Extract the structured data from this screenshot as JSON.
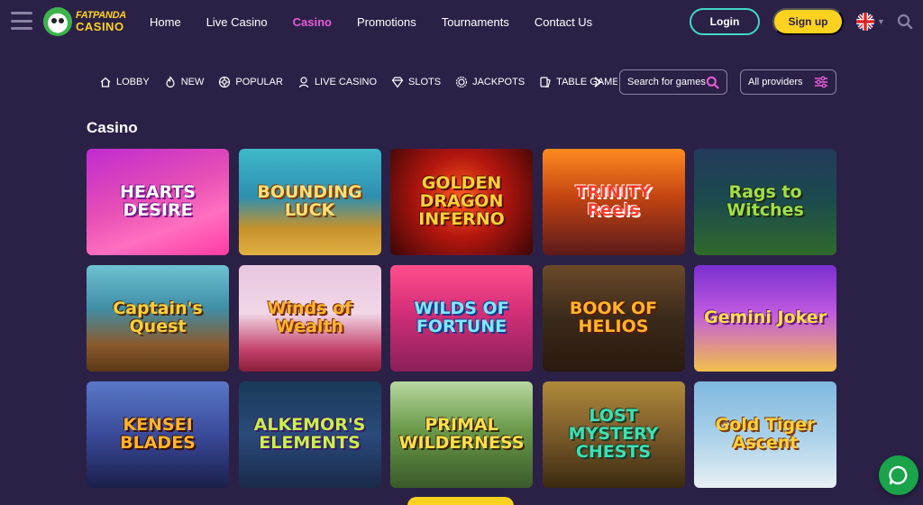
{
  "header": {
    "logo": {
      "line1": "FATPANDA",
      "line2": "CASINO"
    },
    "nav": [
      {
        "label": "Home"
      },
      {
        "label": "Live Casino"
      },
      {
        "label": "Casino",
        "active": true
      },
      {
        "label": "Promotions"
      },
      {
        "label": "Tournaments"
      },
      {
        "label": "Contact Us"
      }
    ],
    "login_label": "Login",
    "signup_label": "Sign up",
    "language_flag": "uk-flag"
  },
  "categories": [
    {
      "label": "LOBBY",
      "icon": "home-icon"
    },
    {
      "label": "NEW",
      "icon": "flame-icon"
    },
    {
      "label": "POPULAR",
      "icon": "target-icon"
    },
    {
      "label": "LIVE CASINO",
      "icon": "dealer-icon"
    },
    {
      "label": "SLOTS",
      "icon": "diamond-icon"
    },
    {
      "label": "JACKPOTS",
      "icon": "coin-icon"
    },
    {
      "label": "TABLE GAMES",
      "icon": "cards-icon"
    }
  ],
  "search": {
    "placeholder": "Search for games"
  },
  "providers": {
    "label": "All providers"
  },
  "section_title": "Casino",
  "games": [
    {
      "title": "HEARTS DESIRE",
      "bg": "linear-gradient(160deg,#c02bd0 0%,#e64fb5 45%,#ff6fc0 70%,#ff3aa4 100%)",
      "color": "#ffffff",
      "shadow": "#7a1a8a"
    },
    {
      "title": "BOUNDING LUCK",
      "bg": "linear-gradient(180deg,#3fb8c9 0%,#2e8fb0 45%,#c8922b 75%,#e0b043 100%)",
      "color": "#ffe07a",
      "shadow": "#7a3f10"
    },
    {
      "title": "GOLDEN DRAGON INFERNO",
      "bg": "radial-gradient(circle at 50% 45%,#ff5a1f 0%,#b3160e 45%,#3a0606 100%)",
      "color": "#ffd03a",
      "shadow": "#5a0f00"
    },
    {
      "title": "TRINITY Reels",
      "bg": "linear-gradient(180deg,#ff8a1f 0%,#c44412 45%,#5b1a1a 100%)",
      "color": "#ff3a2a",
      "shadow": "#ffffff"
    },
    {
      "title": "Rags to Witches",
      "bg": "linear-gradient(180deg,#243a5c 0%,#1b4b4d 50%,#2f6a2b 100%)",
      "color": "#9ee04a",
      "shadow": "#1f2a14"
    },
    {
      "title": "Captain's Quest",
      "bg": "linear-gradient(180deg,#6fc1d3 0%,#3f8fa8 40%,#8a5a2b 75%,#5a3816 100%)",
      "color": "#ffd03a",
      "shadow": "#4a2a0c"
    },
    {
      "title": "Winds of Wealth",
      "bg": "linear-gradient(180deg,#e7c6e0 0%,#f2d7e6 45%,#c2406a 80%,#8a1f3a 100%)",
      "color": "#ffb52a",
      "shadow": "#7a2a10"
    },
    {
      "title": "WILDS OF FORTUNE",
      "bg": "linear-gradient(180deg,#ff4f8a 0%,#d8307a 40%,#8a1f5a 100%)",
      "color": "#7fe8ff",
      "shadow": "#1a3a8a"
    },
    {
      "title": "BOOK OF HELIOS",
      "bg": "linear-gradient(180deg,#6b4a2a 0%,#3a2a1a 50%,#2a1a10 100%)",
      "color": "#ffb52a",
      "shadow": "#5a1a00"
    },
    {
      "title": "Gemini Joker",
      "bg": "linear-gradient(180deg,#7a2fd0 0%,#c05ae0 45%,#f3c04a 100%)",
      "color": "#ffe14a",
      "shadow": "#6a1a8a"
    },
    {
      "title": "KENSEI BLADES",
      "bg": "linear-gradient(180deg,#5a78c8 0%,#3a4a9a 50%,#1a1f4a 100%)",
      "color": "#ffb52a",
      "shadow": "#3a0f0a"
    },
    {
      "title": "ALKEMOR'S ELEMENTS",
      "bg": "linear-gradient(180deg,#1a3a5a 0%,#2a4a7a 50%,#1a2a4a 100%)",
      "color": "#c9f04a",
      "shadow": "#3a1a6a"
    },
    {
      "title": "PRIMAL WILDERNESS",
      "bg": "linear-gradient(180deg,#b8d8a0 0%,#6a9a4a 45%,#3a5a2a 100%)",
      "color": "#ffe14a",
      "shadow": "#3a2a10"
    },
    {
      "title": "LOST MYSTERY CHESTS",
      "bg": "linear-gradient(180deg,#b08a3a 0%,#7a5a2a 50%,#3a2a10 100%)",
      "color": "#3fe0b0",
      "shadow": "#1a3a2a"
    },
    {
      "title": "Gold Tiger Ascent",
      "bg": "linear-gradient(180deg,#7fb8e0 0%,#a8d0e8 50%,#e8f0f5 100%)",
      "color": "#ffd03a",
      "shadow": "#7a3a10"
    }
  ]
}
